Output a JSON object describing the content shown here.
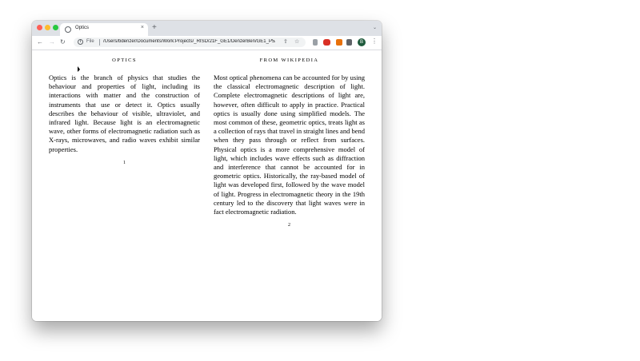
{
  "browser": {
    "tab_title": "Optics",
    "tab_close_glyph": "×",
    "new_tab_glyph": "+",
    "tab_search_glyph": "⌄",
    "nav": {
      "back": "←",
      "forward": "→",
      "reload": "↻"
    },
    "address_scheme": "File",
    "address_url": "/Users/bdenzer/Documents/Work:Projects/_RISD/21F_GE1/DenzerBen/GE1_P5/sou...",
    "omnibox_icons": {
      "share": "⇪",
      "bookmark": "☆"
    },
    "profile_initial": "B",
    "menu_glyph": "⋮",
    "colors": {
      "tabbar": "#dee1e6",
      "close": "#ff5f57",
      "minimize": "#febc2e",
      "maximize": "#28c840"
    }
  },
  "page": {
    "left": {
      "heading": "OPTICS",
      "text": "Optics is the branch of physics that studies the behaviour and properties of light, including its interactions with matter and the construction of instruments that use or detect it. Optics usually describes the behaviour of visible, ultraviolet, and infrared light. Because light is an electromagnetic wave, other forms of electromagnetic radiation such as X-rays, microwaves, and radio waves exhibit similar properties.",
      "page_number": "1"
    },
    "right": {
      "heading": "FROM WIKIPEDIA",
      "text": "Most optical phenomena can be accounted for by using the classical electromagnetic description of light. Complete electromagnetic descriptions of light are, however, often difficult to apply in practice. Practical optics is usually done using simplified models. The most common of these, geometric optics, treats light as a collection of rays that travel in straight lines and bend when they pass through or reflect from surfaces. Physical optics is a more comprehensive model of light, which includes wave effects such as diffraction and interference that cannot be accounted for in geometric optics. Historically, the ray-based model of light was developed first, followed by the wave model of light. Progress in electromagnetic theory in the 19th century led to the discovery that light waves were in fact electromagnetic radiation.",
      "page_number": "2"
    }
  }
}
